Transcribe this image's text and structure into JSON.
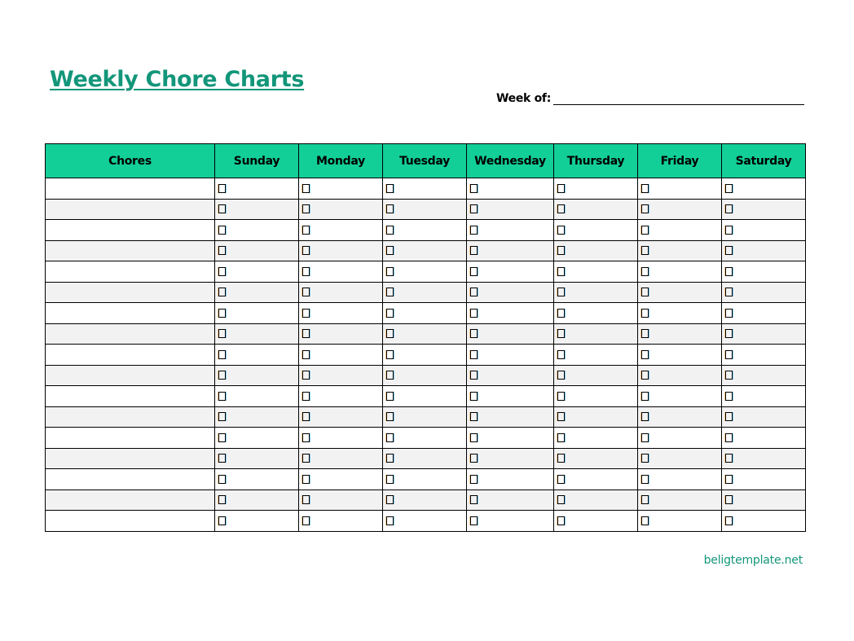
{
  "document": {
    "title": "Weekly Chore Charts",
    "week_of_label": "Week of:",
    "week_of_value": "",
    "footer": "beligtemplate.net"
  },
  "colors": {
    "accent": "#13967a",
    "header_fill": "#12cf98",
    "alt_row_fill": "#f2f2f2"
  },
  "table": {
    "columns": [
      "Chores",
      "Sunday",
      "Monday",
      "Tuesday",
      "Wednesday",
      "Thursday",
      "Friday",
      "Saturday"
    ],
    "checkbox_icon": "empty-checkbox",
    "rows": [
      {
        "chore": "",
        "checks": [
          false,
          false,
          false,
          false,
          false,
          false,
          false
        ]
      },
      {
        "chore": "",
        "checks": [
          false,
          false,
          false,
          false,
          false,
          false,
          false
        ]
      },
      {
        "chore": "",
        "checks": [
          false,
          false,
          false,
          false,
          false,
          false,
          false
        ]
      },
      {
        "chore": "",
        "checks": [
          false,
          false,
          false,
          false,
          false,
          false,
          false
        ]
      },
      {
        "chore": "",
        "checks": [
          false,
          false,
          false,
          false,
          false,
          false,
          false
        ]
      },
      {
        "chore": "",
        "checks": [
          false,
          false,
          false,
          false,
          false,
          false,
          false
        ]
      },
      {
        "chore": "",
        "checks": [
          false,
          false,
          false,
          false,
          false,
          false,
          false
        ]
      },
      {
        "chore": "",
        "checks": [
          false,
          false,
          false,
          false,
          false,
          false,
          false
        ]
      },
      {
        "chore": "",
        "checks": [
          false,
          false,
          false,
          false,
          false,
          false,
          false
        ]
      },
      {
        "chore": "",
        "checks": [
          false,
          false,
          false,
          false,
          false,
          false,
          false
        ]
      },
      {
        "chore": "",
        "checks": [
          false,
          false,
          false,
          false,
          false,
          false,
          false
        ]
      },
      {
        "chore": "",
        "checks": [
          false,
          false,
          false,
          false,
          false,
          false,
          false
        ]
      },
      {
        "chore": "",
        "checks": [
          false,
          false,
          false,
          false,
          false,
          false,
          false
        ]
      },
      {
        "chore": "",
        "checks": [
          false,
          false,
          false,
          false,
          false,
          false,
          false
        ]
      },
      {
        "chore": "",
        "checks": [
          false,
          false,
          false,
          false,
          false,
          false,
          false
        ]
      },
      {
        "chore": "",
        "checks": [
          false,
          false,
          false,
          false,
          false,
          false,
          false
        ]
      },
      {
        "chore": "",
        "checks": [
          false,
          false,
          false,
          false,
          false,
          false,
          false
        ]
      }
    ]
  }
}
